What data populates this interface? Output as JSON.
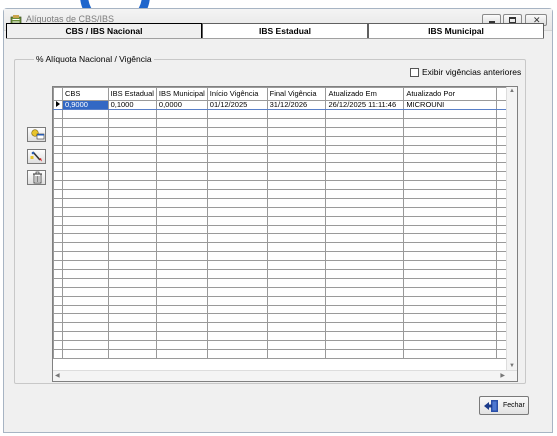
{
  "window": {
    "title": "Alíquotas de CBS/IBS"
  },
  "tabs": [
    {
      "label": "CBS / IBS Nacional",
      "active": true
    },
    {
      "label": "IBS Estadual",
      "active": false
    },
    {
      "label": "IBS Municipal",
      "active": false
    }
  ],
  "group": {
    "legend": "% Alíquota Nacional / Vigência",
    "show_previous_label": "Exibir vigências anteriores",
    "show_previous_checked": false
  },
  "side_buttons": [
    {
      "icon": "add-record-icon"
    },
    {
      "icon": "edit-record-icon"
    },
    {
      "icon": "trash-icon"
    }
  ],
  "grid": {
    "columns": [
      "CBS",
      "IBS Estadual",
      "IBS Municipal",
      "Início Vigência",
      "Final Vigência",
      "Atualizado Em",
      "Atualizado Por"
    ],
    "rows": [
      [
        "0,9000",
        "0,1000",
        "0,0000",
        "01/12/2025",
        "31/12/2026",
        "26/12/2025 11:11:46",
        "MICROUNI"
      ]
    ],
    "empty_rows": 28
  },
  "footer": {
    "close_label": "Fechar"
  },
  "colors": {
    "accent": "#1f66cc",
    "selection": "#3368c4"
  }
}
